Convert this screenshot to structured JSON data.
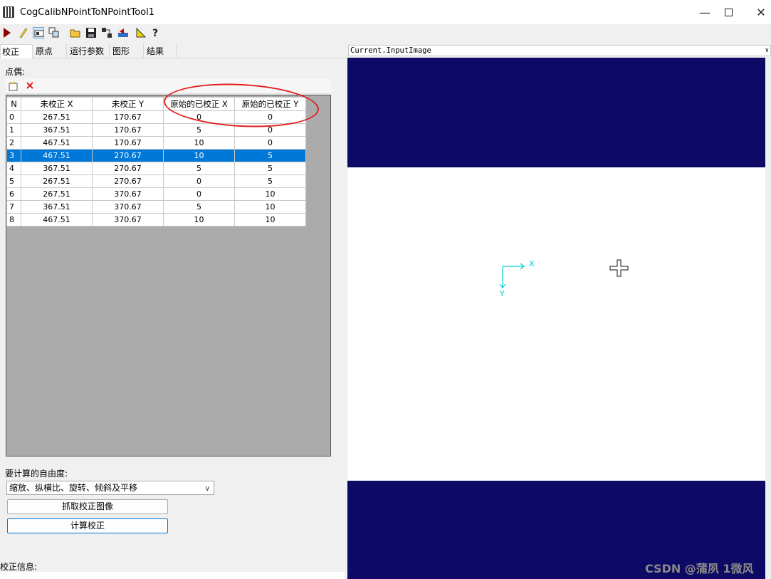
{
  "window": {
    "title": "CogCalibNPointToNPointTool1"
  },
  "icons": [
    "run-icon",
    "edit-icon",
    "display-icon",
    "copy-icon",
    "open-icon",
    "save-icon",
    "link-icon",
    "reset-icon",
    "measure-icon",
    "help-icon"
  ],
  "tabs": [
    {
      "label": "校正",
      "active": true
    },
    {
      "label": "原点",
      "active": false
    },
    {
      "label": "运行参数",
      "active": false
    },
    {
      "label": "图形",
      "active": false
    },
    {
      "label": "结果",
      "active": false
    }
  ],
  "pairs": {
    "label": "点偶:",
    "columns": [
      "N",
      "未校正 X",
      "未校正 Y",
      "原始的已校正 X",
      "原始的已校正 Y"
    ],
    "selected_row": 3,
    "rows": [
      [
        "0",
        "267.51",
        "170.67",
        "0",
        "0"
      ],
      [
        "1",
        "367.51",
        "170.67",
        "5",
        "0"
      ],
      [
        "2",
        "467.51",
        "170.67",
        "10",
        "0"
      ],
      [
        "3",
        "467.51",
        "270.67",
        "10",
        "5"
      ],
      [
        "4",
        "367.51",
        "270.67",
        "5",
        "5"
      ],
      [
        "5",
        "267.51",
        "270.67",
        "0",
        "5"
      ],
      [
        "6",
        "267.51",
        "370.67",
        "0",
        "10"
      ],
      [
        "7",
        "367.51",
        "370.67",
        "5",
        "10"
      ],
      [
        "8",
        "467.51",
        "370.67",
        "10",
        "10"
      ]
    ]
  },
  "dof": {
    "label": "要计算的自由度:",
    "value": "缩放、纵横比、旋转、倾斜及平移"
  },
  "buttons": {
    "grab": "抓取校正图像",
    "compute": "计算校正"
  },
  "info_label": "校正信息:",
  "display": {
    "source": "Current.InputImage",
    "axis_x": "X",
    "axis_y": "Y",
    "band_color": "#0c0a64",
    "axis_color": "#00cccc"
  },
  "watermark": "CSDN @蒲夙 1微风",
  "colors": {
    "selection": "#0078d7",
    "annotation": "#e02020"
  }
}
